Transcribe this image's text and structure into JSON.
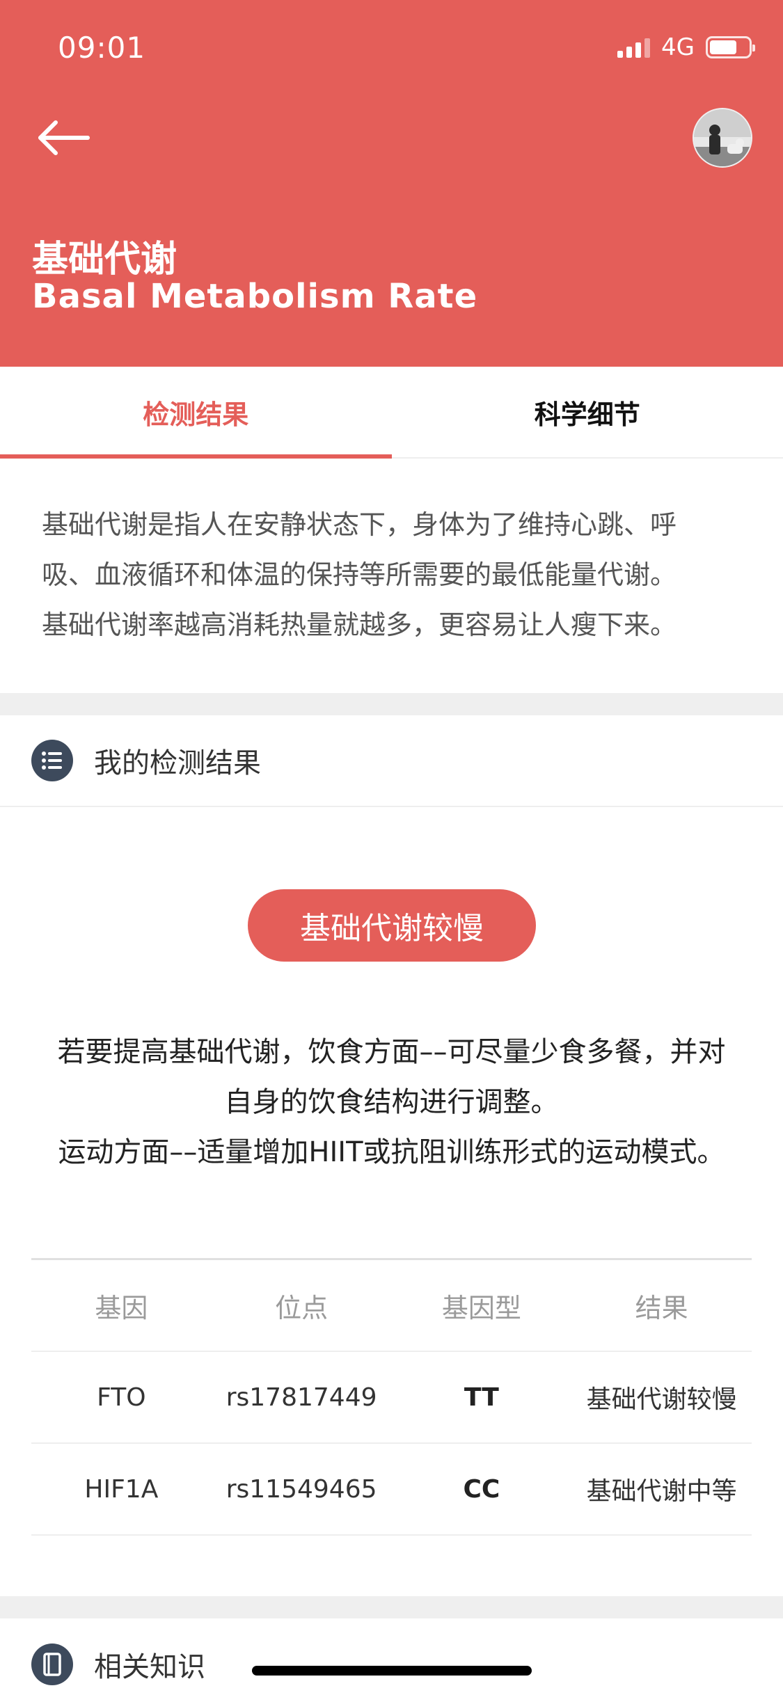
{
  "status_bar": {
    "time": "09:01",
    "network": "4G"
  },
  "header": {
    "title_cn": "基础代谢",
    "title_en": "Basal Metabolism Rate"
  },
  "tabs": [
    {
      "label": "检测结果",
      "active": true
    },
    {
      "label": "科学细节",
      "active": false
    }
  ],
  "intro": {
    "lines": [
      "基础代谢是指人在安静状态下，身体为了维持心跳、呼",
      "吸、血液循环和体温的保持等所需要的最低能量代谢。",
      "基础代谢率越高消耗热量就越多，更容易让人瘦下来。"
    ]
  },
  "my_results": {
    "label": "我的检测结果"
  },
  "result_badge": "基础代谢较慢",
  "advice": {
    "lines": [
      "若要提高基础代谢，饮食方面––可尽量少食多餐，并对",
      "自身的饮食结构进行调整。",
      "运动方面––适量增加HIIT或抗阻训练形式的运动模式。"
    ]
  },
  "table": {
    "headers": [
      "基因",
      "位点",
      "基因型",
      "结果"
    ],
    "rows": [
      [
        "FTO",
        "rs17817449",
        "TT",
        "基础代谢较慢"
      ],
      [
        "HIF1A",
        "rs11549465",
        "CC",
        "基础代谢中等"
      ]
    ]
  },
  "related": {
    "label": "相关知识"
  },
  "colors": {
    "accent": "#e45e59",
    "icon_dark": "#3d4a5c"
  },
  "icons": {
    "back": "arrow-left-icon",
    "list": "list-icon",
    "book": "book-icon",
    "signal": "signal-icon",
    "battery": "battery-icon"
  }
}
